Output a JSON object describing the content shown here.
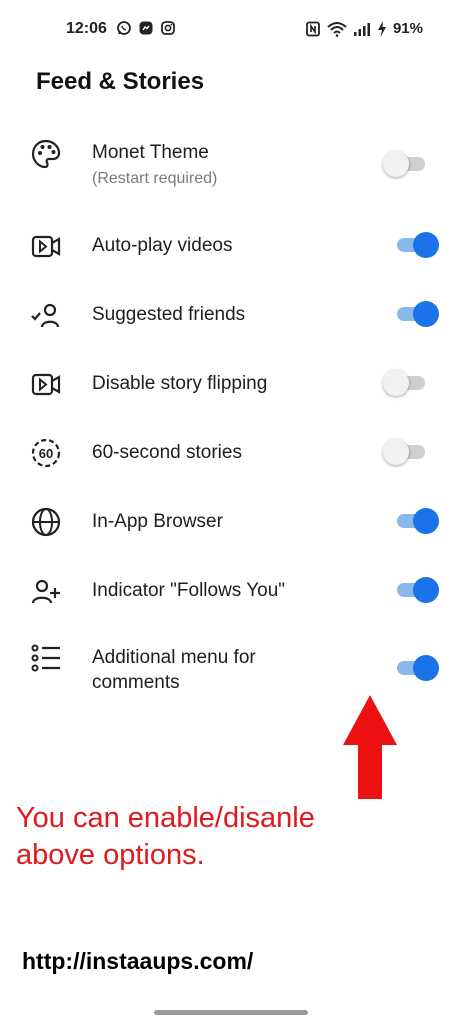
{
  "status_bar": {
    "time": "12:06",
    "battery": "91%",
    "app_icons": [
      "whatsapp-icon",
      "messenger-icon",
      "instagram-icon"
    ],
    "right_icons": [
      "nfc-icon",
      "wifi-icon",
      "signal-icon",
      "charging-icon"
    ]
  },
  "page_title": "Feed & Stories",
  "settings": [
    {
      "label": "Monet Theme",
      "sublabel": "(Restart required)",
      "icon": "palette-icon",
      "enabled": false
    },
    {
      "label": "Auto-play videos",
      "icon": "video-icon",
      "enabled": true
    },
    {
      "label": "Suggested friends",
      "icon": "suggested-friends-icon",
      "enabled": true
    },
    {
      "label": "Disable story flipping",
      "icon": "video-icon",
      "enabled": false
    },
    {
      "label": "60-second stories",
      "icon": "sixty-seconds-icon",
      "enabled": false
    },
    {
      "label": "In-App Browser",
      "icon": "globe-icon",
      "enabled": true
    },
    {
      "label": "Indicator \"Follows You\"",
      "icon": "add-person-icon",
      "enabled": true
    },
    {
      "label": "Additional menu for comments",
      "label_lines": [
        "Additional menu for",
        "comments"
      ],
      "icon": "list-icon",
      "enabled": true
    }
  ],
  "annotation": {
    "lines": [
      "You can enable/disanle",
      "above options."
    ],
    "color": "#e0191f",
    "arrow": "red-up-arrow-icon"
  },
  "footer_url": "http://instaaups.com/",
  "colors": {
    "toggle_on": "#1a73e8",
    "toggle_on_track": "#8ab8ea",
    "toggle_off_track": "#cfcfcf"
  }
}
